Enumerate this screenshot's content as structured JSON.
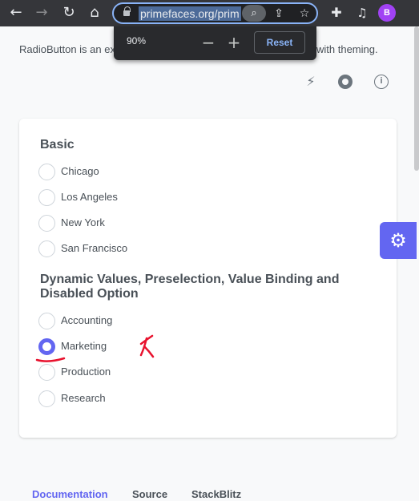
{
  "browser": {
    "url": "primefaces.org/prim",
    "avatar_initial": "B"
  },
  "zoom_popup": {
    "level": "90%",
    "reset_label": "Reset"
  },
  "page": {
    "intro_start": "RadioButton is an ex",
    "intro_end": "with theming.",
    "icons": [
      "bolt-icon",
      "github-icon",
      "info-icon"
    ]
  },
  "card": {
    "basic_heading": "Basic",
    "basic_options": [
      {
        "label": "Chicago",
        "checked": false
      },
      {
        "label": "Los Angeles",
        "checked": false
      },
      {
        "label": "New York",
        "checked": false
      },
      {
        "label": "San Francisco",
        "checked": false
      }
    ],
    "dynamic_heading": "Dynamic Values, Preselection, Value Binding and Disabled Option",
    "dynamic_options": [
      {
        "label": "Accounting",
        "checked": false
      },
      {
        "label": "Marketing",
        "checked": true
      },
      {
        "label": "Production",
        "checked": false
      },
      {
        "label": "Research",
        "checked": false
      }
    ]
  },
  "bottom_tabs": {
    "documentation": "Documentation",
    "source": "Source",
    "stackblitz": "StackBlitz"
  },
  "colors": {
    "accent": "#6366f1",
    "annotation": "#e8112d"
  }
}
